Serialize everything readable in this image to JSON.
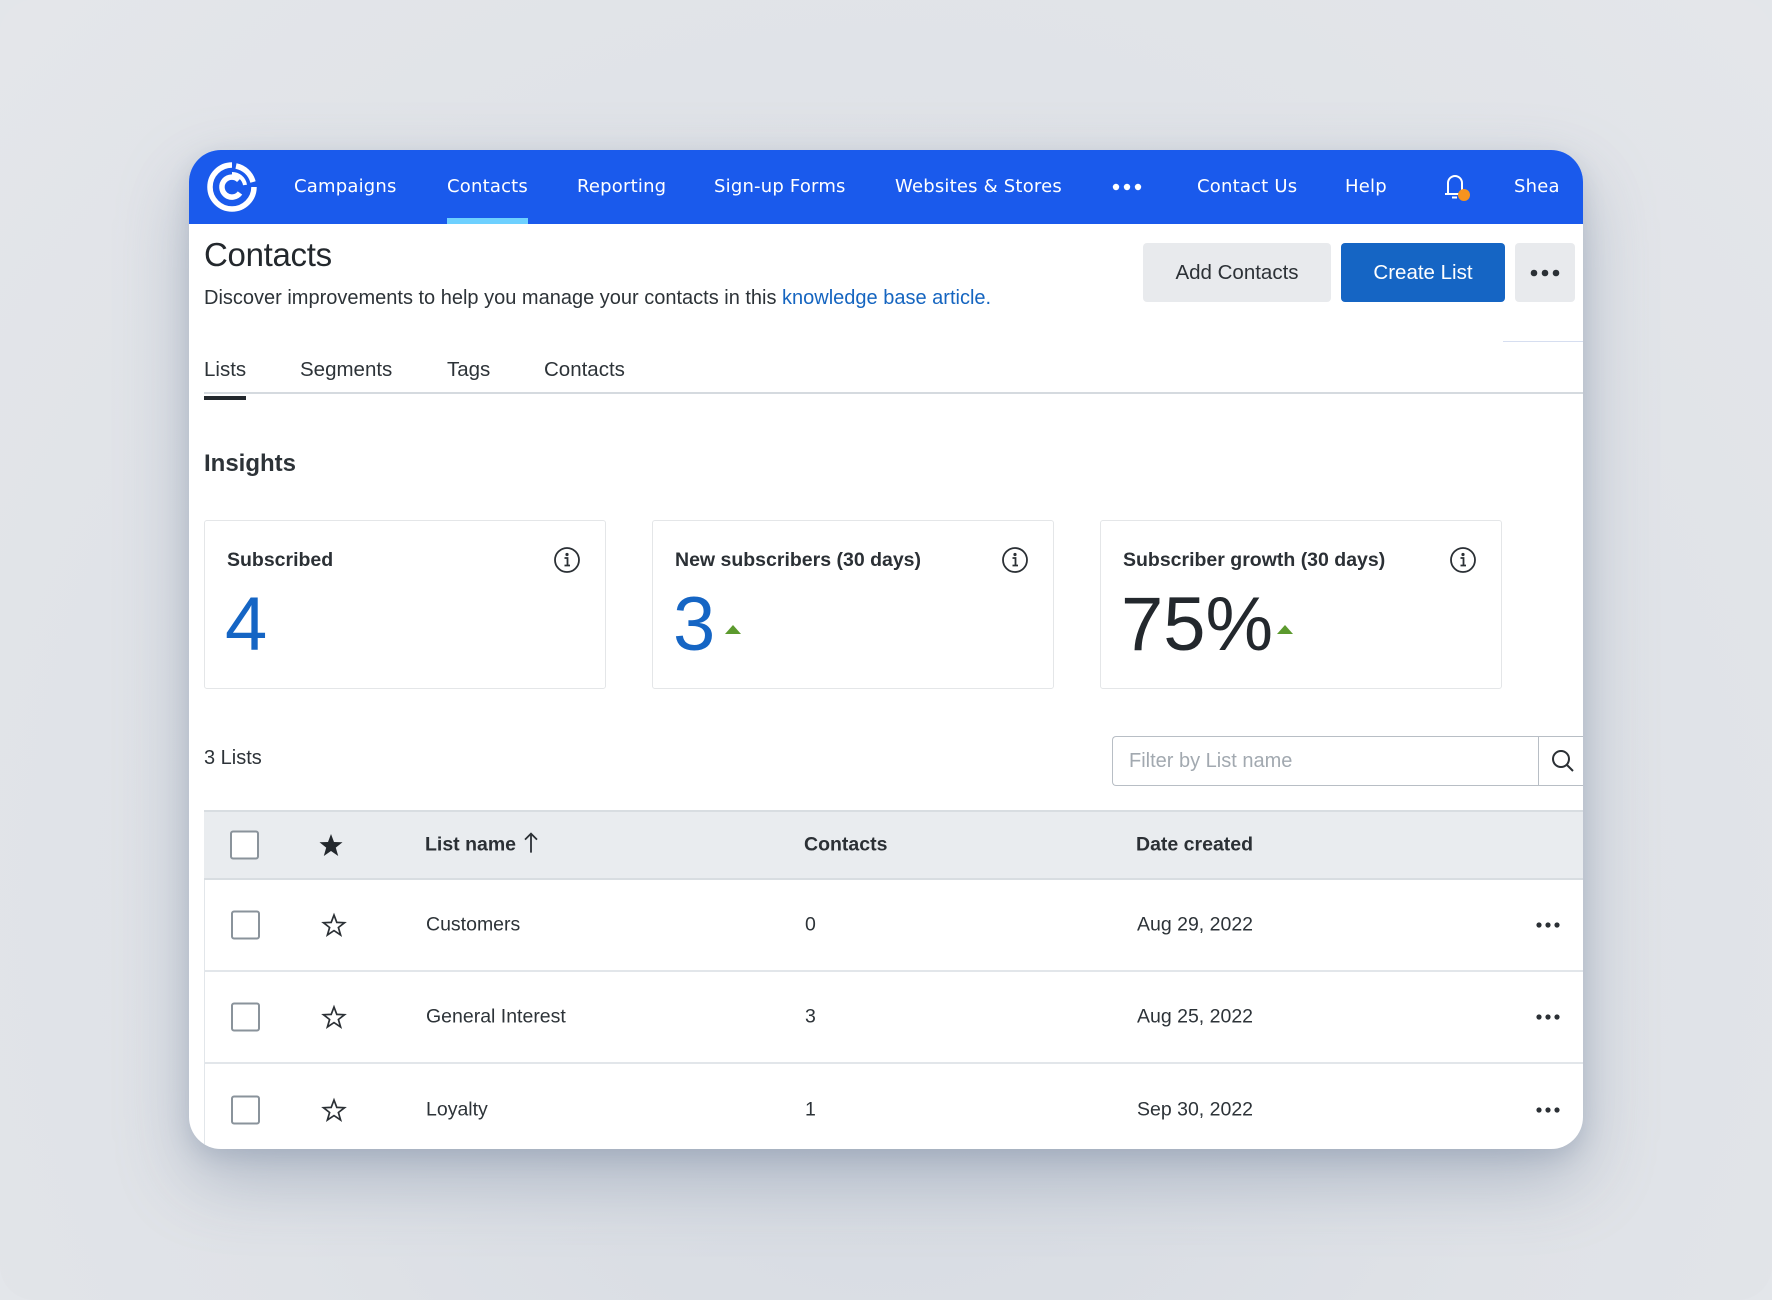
{
  "nav": {
    "logo": "constant-contact-logo",
    "items": [
      {
        "label": "Campaigns",
        "active": false
      },
      {
        "label": "Contacts",
        "active": true
      },
      {
        "label": "Reporting",
        "active": false
      },
      {
        "label": "Sign-up Forms",
        "active": false
      },
      {
        "label": "Websites & Stores",
        "active": false
      }
    ],
    "more_icon": "more-horizontal-icon",
    "contact_us": "Contact Us",
    "help": "Help",
    "notification_icon": "bell-icon",
    "notification_dot_color": "#f7931e",
    "user": "Shea",
    "bg_color": "#1a5aec",
    "active_underline_color": "#6dd0ff"
  },
  "header": {
    "title": "Contacts",
    "subtitle_prefix": "Discover improvements to help you manage your contacts in this ",
    "subtitle_link": "knowledge base article.",
    "add_contacts": "Add Contacts",
    "create_list": "Create List",
    "more_icon": "more-horizontal-icon"
  },
  "tabs": [
    {
      "label": "Lists",
      "active": true
    },
    {
      "label": "Segments",
      "active": false
    },
    {
      "label": "Tags",
      "active": false
    },
    {
      "label": "Contacts",
      "active": false
    }
  ],
  "insights": {
    "title": "Insights",
    "cards": [
      {
        "label": "Subscribed",
        "value": "4",
        "trend": null
      },
      {
        "label": "New subscribers (30 days)",
        "value": "3",
        "trend": "up"
      },
      {
        "label": "Subscriber growth (30 days)",
        "value": "75%",
        "trend": "up"
      }
    ],
    "trend_color": "#5c9a2e"
  },
  "lists": {
    "count_label": "3 Lists",
    "filter_placeholder": "Filter by List name",
    "filter_value": "",
    "columns": {
      "name": "List name",
      "contacts": "Contacts",
      "date": "Date created",
      "sort": "ascending"
    },
    "rows": [
      {
        "name": "Customers",
        "contacts": "0",
        "date": "Aug 29, 2022",
        "starred": false,
        "checked": false
      },
      {
        "name": "General Interest",
        "contacts": "3",
        "date": "Aug 25, 2022",
        "starred": false,
        "checked": false
      },
      {
        "name": "Loyalty",
        "contacts": "1",
        "date": "Sep 30, 2022",
        "starred": false,
        "checked": false
      }
    ]
  }
}
